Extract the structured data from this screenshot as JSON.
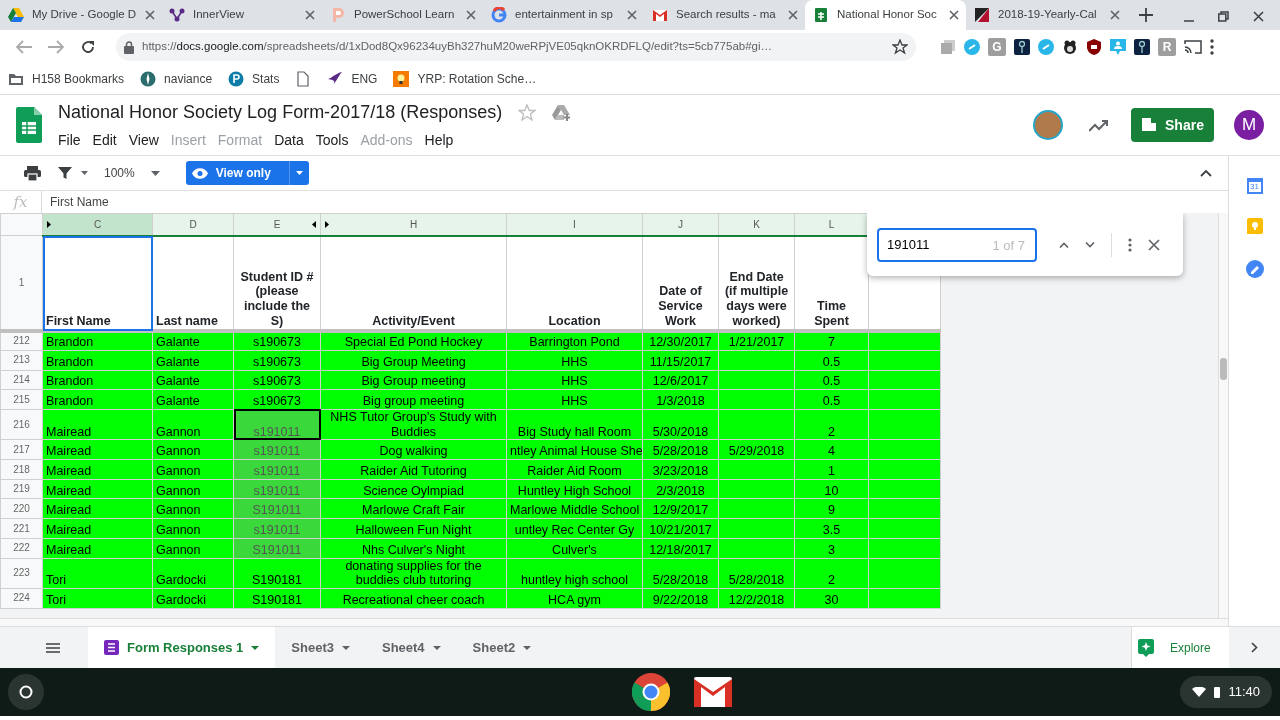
{
  "browser": {
    "tabs": [
      {
        "title": "My Drive - Google D",
        "selected": false
      },
      {
        "title": "InnerView",
        "selected": false
      },
      {
        "title": "PowerSchool Learn",
        "selected": false
      },
      {
        "title": "entertainment in sp",
        "selected": false
      },
      {
        "title": "Search results - ma",
        "selected": false
      },
      {
        "title": "National Honor Soc",
        "selected": true
      },
      {
        "title": "2018-19-Yearly-Cal",
        "selected": false
      }
    ],
    "url": {
      "scheme": "https://",
      "host": "docs.google.com",
      "path": "/spreadsheets/d/1xDod8Qx96234uyBh327huM20weRPjVE05qknOKRDFLQ/edit?ts=5cb775ab#gi…"
    },
    "extensions": [
      {
        "kind": "copy"
      },
      {
        "kind": "link"
      },
      {
        "kind": "letter",
        "label": "G"
      },
      {
        "kind": "key"
      },
      {
        "kind": "link"
      },
      {
        "kind": "guard"
      },
      {
        "kind": "shield"
      },
      {
        "kind": "person"
      },
      {
        "kind": "key"
      },
      {
        "kind": "letter",
        "label": "R"
      }
    ],
    "bookmarks": [
      {
        "kind": "link",
        "label": "H158 Bookmarks"
      },
      {
        "kind": "link",
        "label": "naviance"
      },
      {
        "kind": "link",
        "label": "Stats"
      },
      {
        "kind": "icon_only"
      },
      {
        "kind": "link",
        "label": "ENG"
      },
      {
        "kind": "link",
        "label": "YRP: Rotation Sche…"
      }
    ]
  },
  "doc": {
    "title": "National Honor Society Log Form-2017/18 (Responses)",
    "menu": [
      {
        "label": "File",
        "disabled": false
      },
      {
        "label": "Edit",
        "disabled": false
      },
      {
        "label": "View",
        "disabled": false
      },
      {
        "label": "Insert",
        "disabled": true
      },
      {
        "label": "Format",
        "disabled": true
      },
      {
        "label": "Data",
        "disabled": false
      },
      {
        "label": "Tools",
        "disabled": false
      },
      {
        "label": "Add-ons",
        "disabled": true
      },
      {
        "label": "Help",
        "disabled": false
      }
    ],
    "share_label": "Share",
    "account_initial": "M"
  },
  "toolbar": {
    "zoom": "100%",
    "mode": "View only"
  },
  "formula_bar": {
    "label": "fx",
    "value": "First Name"
  },
  "sheet": {
    "header_row": "1",
    "columns": [
      {
        "letter": "C",
        "heading": "First Name",
        "selected": true
      },
      {
        "letter": "D",
        "heading": "Last name",
        "selected": false
      },
      {
        "letter": "E",
        "heading": "Student ID # (please include the S)",
        "selected": false
      },
      {
        "letter": "H",
        "heading": "Activity/Event",
        "selected": false
      },
      {
        "letter": "I",
        "heading": "Location",
        "selected": false
      },
      {
        "letter": "J",
        "heading": "Date of Service Work",
        "selected": false
      },
      {
        "letter": "K",
        "heading": "End Date (if multiple days were worked)",
        "selected": false
      },
      {
        "letter": "L",
        "heading": "Time Spent",
        "selected": false
      }
    ],
    "rows": [
      {
        "number": "212",
        "match": false,
        "current": false,
        "cells": [
          "Brandon",
          "Galante",
          "s190673",
          "Special Ed Pond Hockey",
          "Barrington Pond",
          "12/30/2017",
          "1/21/2017",
          "7"
        ]
      },
      {
        "number": "213",
        "match": false,
        "current": false,
        "cells": [
          "Brandon",
          "Galante",
          "s190673",
          "Big Group Meeting",
          "HHS",
          "11/15/2017",
          "",
          "0.5"
        ]
      },
      {
        "number": "214",
        "match": false,
        "current": false,
        "cells": [
          "Brandon",
          "Galante",
          "s190673",
          "Big Group meeting",
          "HHS",
          "12/6/2017",
          "",
          "0.5"
        ]
      },
      {
        "number": "215",
        "match": false,
        "current": false,
        "cells": [
          "Brandon",
          "Galante",
          "s190673",
          "Big group meeting",
          "HHS",
          "1/3/2018",
          "",
          "0.5"
        ]
      },
      {
        "number": "216",
        "match": true,
        "current": true,
        "cells": [
          "Mairead",
          "Gannon",
          "s191011",
          "NHS Tutor Group's Study with Buddies",
          "Big Study hall Room",
          "5/30/2018",
          "",
          "2"
        ]
      },
      {
        "number": "217",
        "match": true,
        "current": false,
        "cells": [
          "Mairead",
          "Gannon",
          "s191011",
          "Dog walking",
          "ntley Animal House She",
          "5/28/2018",
          "5/29/2018",
          "4"
        ]
      },
      {
        "number": "218",
        "match": true,
        "current": false,
        "cells": [
          "Mairead",
          "Gannon",
          "s191011",
          "Raider Aid Tutoring",
          "Raider Aid Room",
          "3/23/2018",
          "",
          "1"
        ]
      },
      {
        "number": "219",
        "match": true,
        "current": false,
        "cells": [
          "Mairead",
          "Gannon",
          "s191011",
          "Science Oylmpiad",
          "Huntley High School",
          "2/3/2018",
          "",
          "10"
        ]
      },
      {
        "number": "220",
        "match": true,
        "current": false,
        "cells": [
          "Mairead",
          "Gannon",
          "S191011",
          "Marlowe Craft Fair",
          "Marlowe Middle School",
          "12/9/2017",
          "",
          "9"
        ]
      },
      {
        "number": "221",
        "match": true,
        "current": false,
        "cells": [
          "Mairead",
          "Gannon",
          "s191011",
          "Halloween Fun Night",
          "untley Rec Center Gy",
          "10/21/2017",
          "",
          "3.5"
        ]
      },
      {
        "number": "222",
        "match": true,
        "current": false,
        "cells": [
          "Mairead",
          "Gannon",
          "S191011",
          "Nhs Culver's Night",
          "Culver's",
          "12/18/2017",
          "",
          "3"
        ]
      },
      {
        "number": "223",
        "match": false,
        "current": false,
        "cells": [
          "Tori",
          "Gardocki",
          "S190181",
          "donating supplies for the buddies club tutoring",
          "huntley high school",
          "5/28/2018",
          "5/28/2018",
          "2"
        ]
      },
      {
        "number": "224",
        "match": false,
        "current": false,
        "cells": [
          "Tori",
          "Gardocki",
          "S190181",
          "Recreational cheer coach",
          "HCA gym",
          "9/22/2018",
          "12/2/2018",
          "30"
        ]
      }
    ]
  },
  "find": {
    "value": "191011",
    "count": "1 of 7"
  },
  "sheet_tabs": [
    {
      "label": "Form Responses 1",
      "selected": true
    },
    {
      "label": "Sheet3",
      "selected": false
    },
    {
      "label": "Sheet4",
      "selected": false
    },
    {
      "label": "Sheet2",
      "selected": false
    }
  ],
  "explore_label": "Explore",
  "side_panel": {
    "calendar_day": "31"
  },
  "shelf": {
    "time": "11:40"
  }
}
